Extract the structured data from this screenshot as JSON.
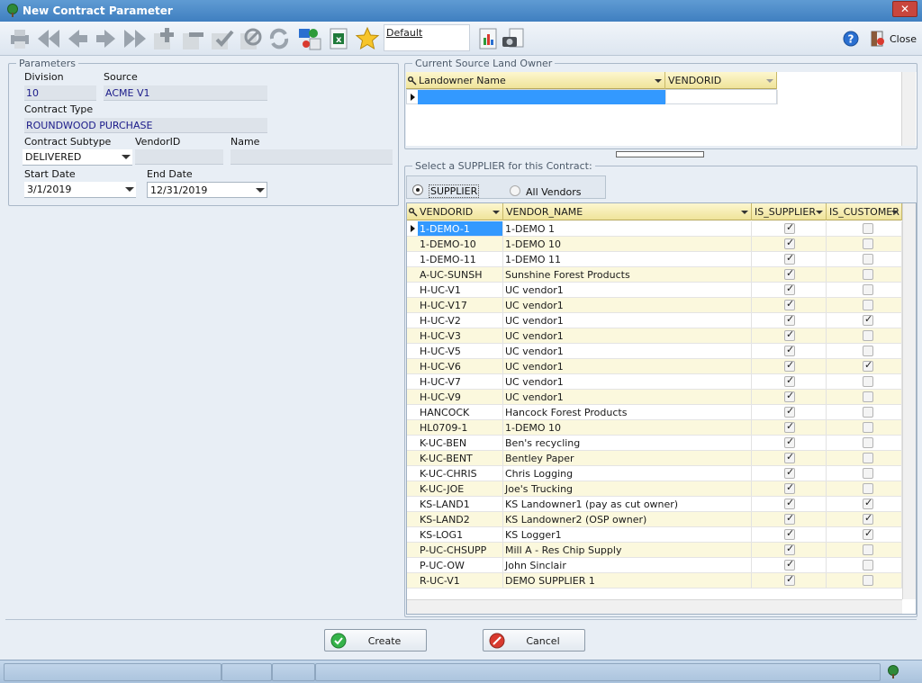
{
  "window": {
    "title": "New Contract Parameter",
    "close_glyph": "✕"
  },
  "toolbar": {
    "default_label": "Default",
    "close_label": "Close"
  },
  "parameters": {
    "legend": "Parameters",
    "division_label": "Division",
    "division_value": "10",
    "source_label": "Source",
    "source_value": "ACME V1",
    "contract_type_label": "Contract Type",
    "contract_type_value": "ROUNDWOOD PURCHASE",
    "subtype_label": "Contract Subtype",
    "subtype_value": "DELIVERED",
    "vendorid_label": "VendorID",
    "vendorid_value": "",
    "name_label": "Name",
    "name_value": "",
    "start_label": "Start Date",
    "start_value": "3/1/2019",
    "end_label": "End Date",
    "end_value": "12/31/2019"
  },
  "landowner": {
    "legend": "Current Source Land Owner",
    "columns": [
      "Landowner Name",
      "VENDORID"
    ]
  },
  "supplier": {
    "legend": "Select a SUPPLIER for this Contract:",
    "radio_supplier": "SUPPLIER",
    "radio_all": "All Vendors",
    "columns": [
      "VENDORID",
      "VENDOR_NAME",
      "IS_SUPPLIER",
      "IS_CUSTOMER"
    ],
    "rows": [
      {
        "id": "1-DEMO-1",
        "name": "1-DEMO 1",
        "sup": true,
        "cust": false
      },
      {
        "id": "1-DEMO-10",
        "name": "1-DEMO 10",
        "sup": true,
        "cust": false
      },
      {
        "id": "1-DEMO-11",
        "name": "1-DEMO 11",
        "sup": true,
        "cust": false
      },
      {
        "id": "A-UC-SUNSH",
        "name": "Sunshine Forest Products",
        "sup": true,
        "cust": false
      },
      {
        "id": "H-UC-V1",
        "name": "UC vendor1",
        "sup": true,
        "cust": false
      },
      {
        "id": "H-UC-V17",
        "name": "UC vendor1",
        "sup": true,
        "cust": false
      },
      {
        "id": "H-UC-V2",
        "name": "UC vendor1",
        "sup": true,
        "cust": true
      },
      {
        "id": "H-UC-V3",
        "name": "UC vendor1",
        "sup": true,
        "cust": false
      },
      {
        "id": "H-UC-V5",
        "name": "UC vendor1",
        "sup": true,
        "cust": false
      },
      {
        "id": "H-UC-V6",
        "name": "UC vendor1",
        "sup": true,
        "cust": true
      },
      {
        "id": "H-UC-V7",
        "name": "UC vendor1",
        "sup": true,
        "cust": false
      },
      {
        "id": "H-UC-V9",
        "name": "UC vendor1",
        "sup": true,
        "cust": false
      },
      {
        "id": "HANCOCK",
        "name": "Hancock Forest Products",
        "sup": true,
        "cust": false
      },
      {
        "id": "HL0709-1",
        "name": "1-DEMO 10",
        "sup": true,
        "cust": false
      },
      {
        "id": "K-UC-BEN",
        "name": "Ben's recycling",
        "sup": true,
        "cust": false
      },
      {
        "id": "K-UC-BENT",
        "name": "Bentley Paper",
        "sup": true,
        "cust": false
      },
      {
        "id": "K-UC-CHRIS",
        "name": "Chris Logging",
        "sup": true,
        "cust": false
      },
      {
        "id": "K-UC-JOE",
        "name": "Joe's Trucking",
        "sup": true,
        "cust": false
      },
      {
        "id": "KS-LAND1",
        "name": "KS Landowner1 (pay as cut owner)",
        "sup": true,
        "cust": true
      },
      {
        "id": "KS-LAND2",
        "name": "KS Landowner2 (OSP owner)",
        "sup": true,
        "cust": true
      },
      {
        "id": "KS-LOG1",
        "name": "KS Logger1",
        "sup": true,
        "cust": true
      },
      {
        "id": "P-UC-CHSUPP",
        "name": "Mill A - Res Chip Supply",
        "sup": true,
        "cust": false
      },
      {
        "id": "P-UC-OW",
        "name": "John Sinclair",
        "sup": true,
        "cust": false
      },
      {
        "id": "R-UC-V1",
        "name": "DEMO SUPPLIER 1",
        "sup": true,
        "cust": false
      }
    ]
  },
  "buttons": {
    "create": "Create",
    "cancel": "Cancel"
  },
  "colors": {
    "title_bar": "#3f7fc0",
    "row_alt": "#fbf8dd",
    "selection": "#3399ff",
    "header": "#efe39a"
  }
}
